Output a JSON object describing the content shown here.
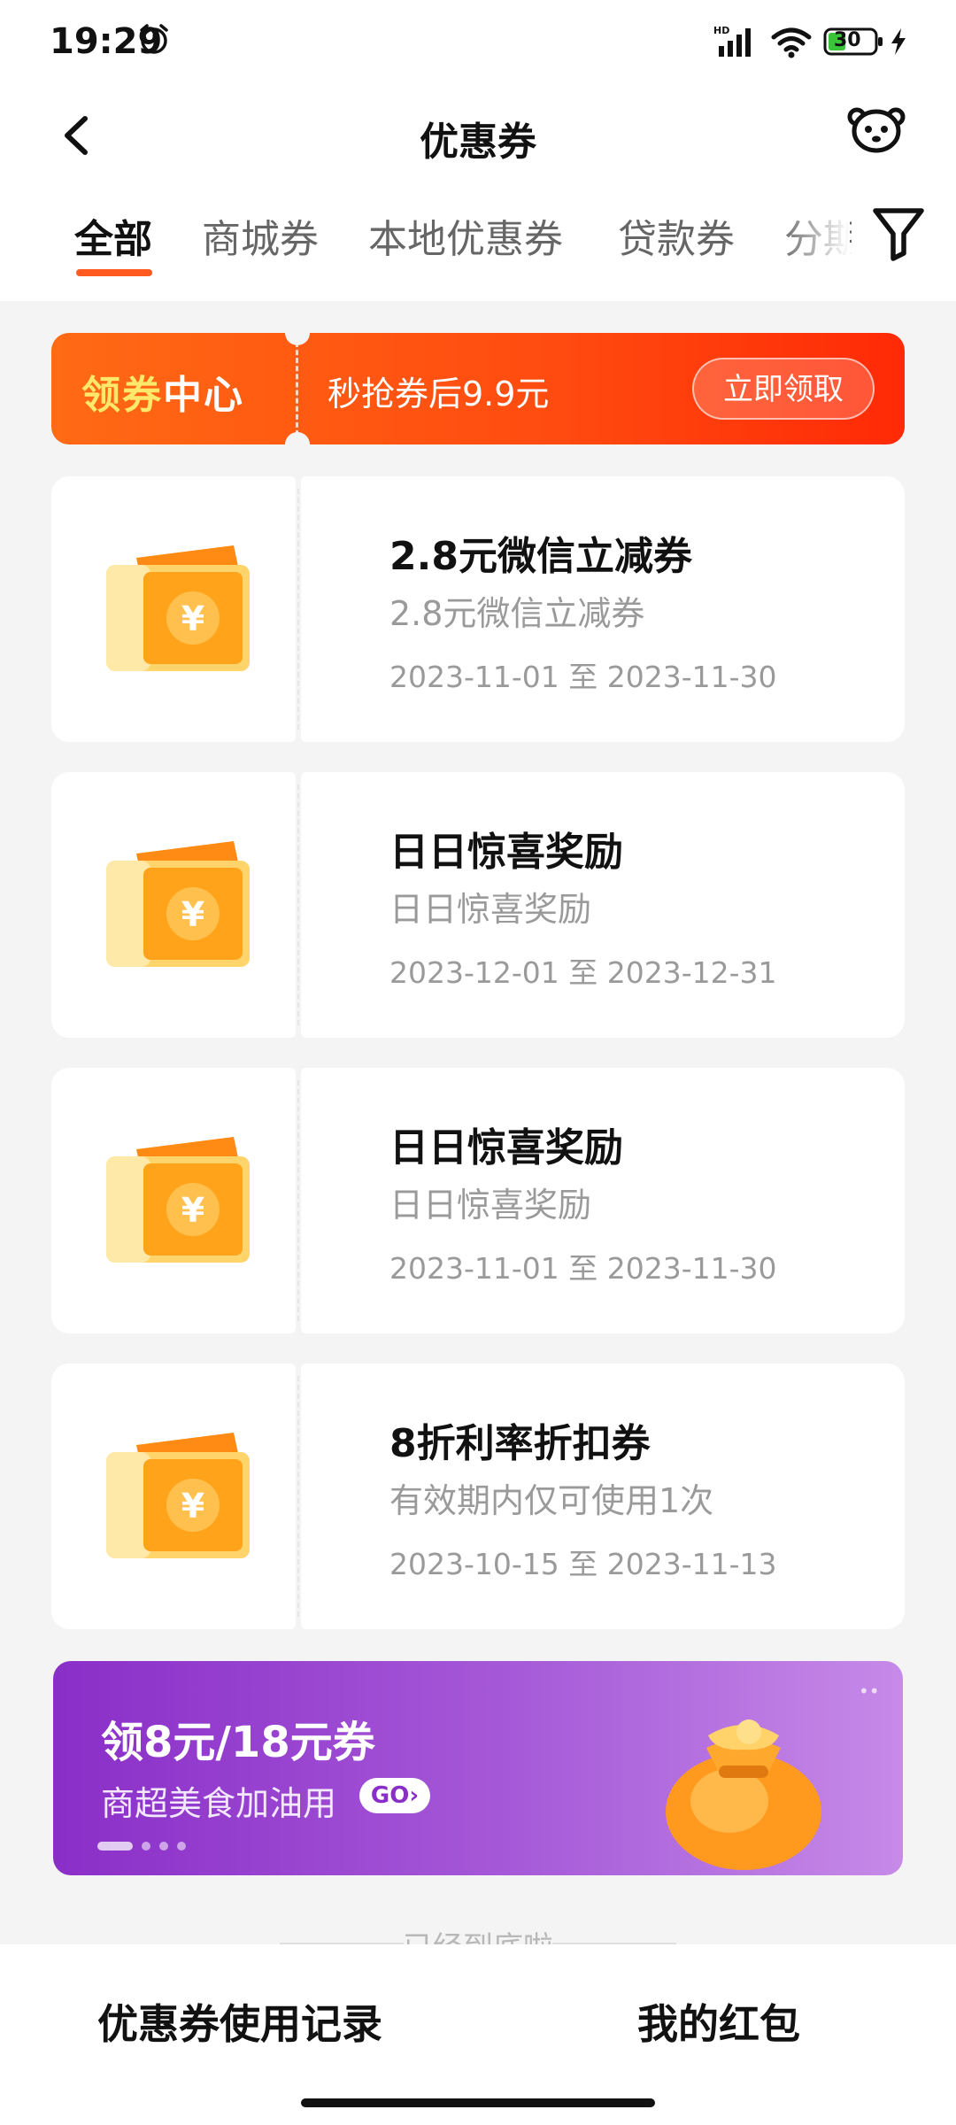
{
  "status_bar": {
    "time": "19:29",
    "battery": "30"
  },
  "header": {
    "title": "优惠券"
  },
  "tabs": [
    {
      "label": "全部",
      "active": true
    },
    {
      "label": "商城券"
    },
    {
      "label": "本地优惠券"
    },
    {
      "label": "贷款券"
    },
    {
      "label": "分期"
    }
  ],
  "banner": {
    "title_part1": "领券",
    "title_part2": "中心",
    "text": "秒抢券后9.9元",
    "button": "立即领取"
  },
  "coupons": [
    {
      "name": "2.8元微信立减券",
      "desc": "2.8元微信立减券",
      "date": "2023-11-01 至 2023-11-30"
    },
    {
      "name": "日日惊喜奖励",
      "desc": "日日惊喜奖励",
      "date": "2023-12-01 至 2023-12-31"
    },
    {
      "name": "日日惊喜奖励",
      "desc": "日日惊喜奖励",
      "date": "2023-11-01 至 2023-11-30"
    },
    {
      "name": "8折利率折扣券",
      "desc": "有效期内仅可使用1次",
      "date": "2023-10-15 至 2023-11-13"
    }
  ],
  "promo": {
    "title": "领8元/18元券",
    "subtitle": "商超美食加油用",
    "go": "GO"
  },
  "footer_hint": "已经到底啦",
  "bottom": {
    "left": "优惠券使用记录",
    "right": "我的红包"
  },
  "colors": {
    "accent": "#ff5a1f",
    "promo": "#8a2ec8",
    "coupon_gold": "#ffa31a"
  }
}
